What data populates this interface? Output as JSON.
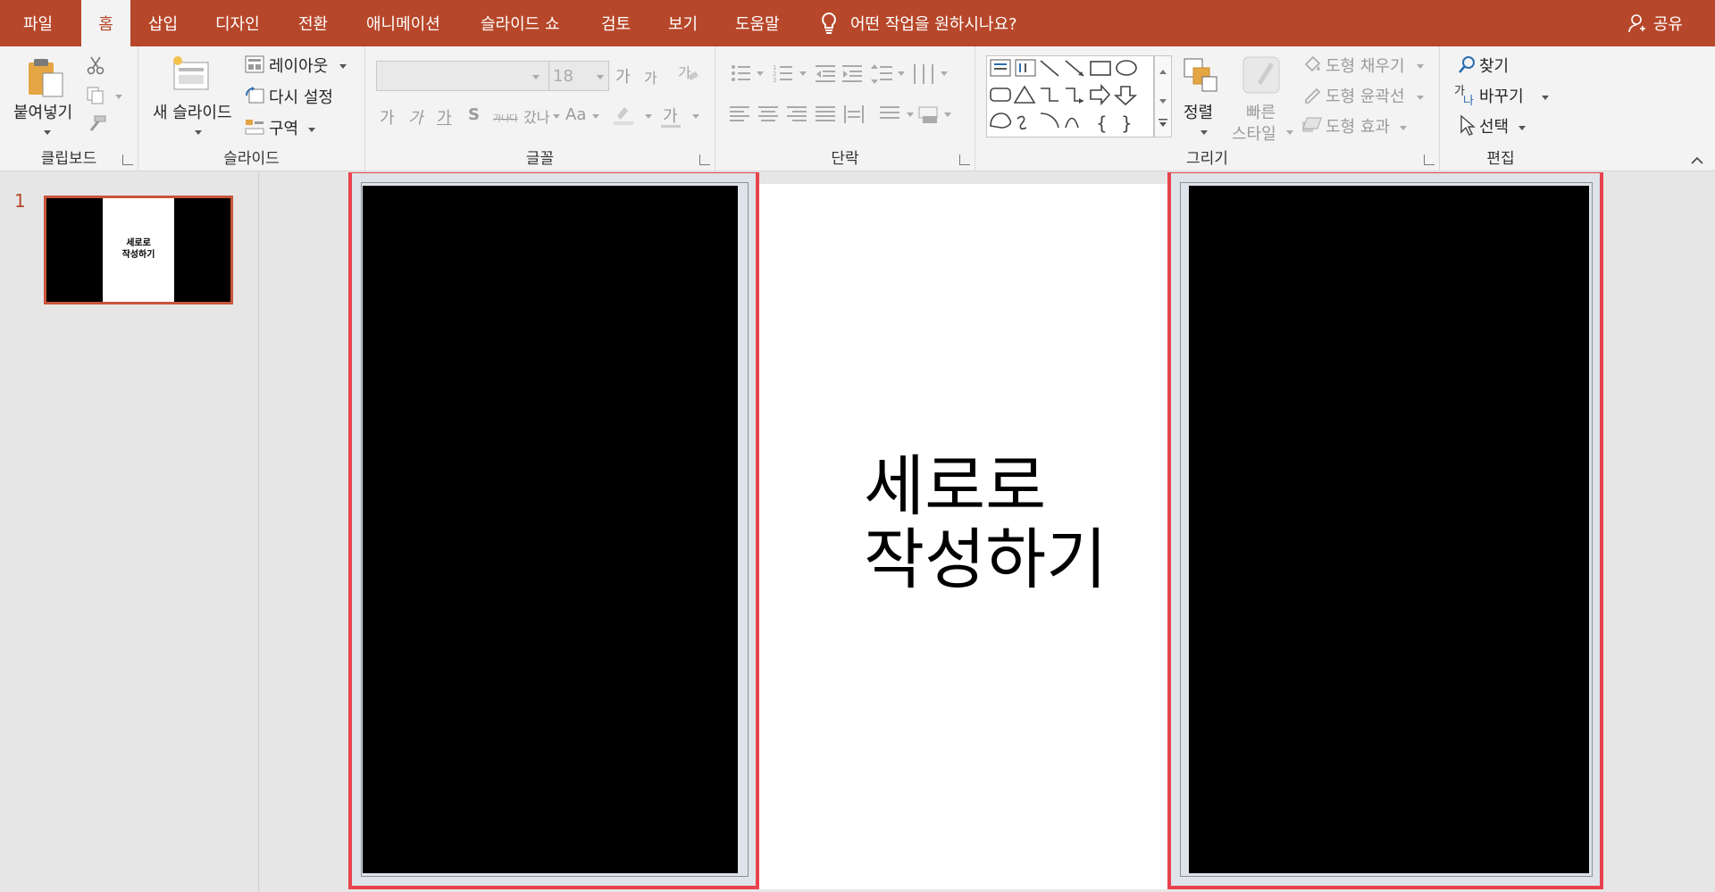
{
  "menu": {
    "tabs": [
      {
        "label": "파일"
      },
      {
        "label": "홈"
      },
      {
        "label": "삽입"
      },
      {
        "label": "디자인"
      },
      {
        "label": "전환"
      },
      {
        "label": "애니메이션"
      },
      {
        "label": "슬라이드 쇼"
      },
      {
        "label": "검토"
      },
      {
        "label": "보기"
      },
      {
        "label": "도움말"
      }
    ],
    "active_tab": "홈",
    "tell_me": "어떤 작업을 원하시나요?",
    "share": "공유"
  },
  "ribbon": {
    "clipboard": {
      "label": "클립보드",
      "paste": "붙여넣기"
    },
    "slides": {
      "label": "슬라이드",
      "new_slide": "새 슬라이드",
      "layout": "레이아웃",
      "reset": "다시 설정",
      "section": "구역"
    },
    "font": {
      "label": "글꼴",
      "font_name": "",
      "font_size": "18",
      "grow": "가",
      "shrink": "가",
      "bold": "가",
      "italic": "가",
      "underline": "가",
      "shadow": "S",
      "strike": "가나다",
      "spacing": "갔나",
      "case": "Aa",
      "color": "가"
    },
    "paragraph": {
      "label": "단락"
    },
    "drawing": {
      "label": "그리기",
      "arrange": "정렬",
      "quick_styles_1": "빠른",
      "quick_styles_2": "스타일",
      "shape_fill": "도형 채우기",
      "shape_outline": "도형 윤곽선",
      "shape_effects": "도형 효과"
    },
    "editing": {
      "label": "편집",
      "find": "찾기",
      "replace": "바꾸기",
      "select": "선택"
    }
  },
  "thumbnails": {
    "number": "1",
    "text_line1": "세로로",
    "text_line2": "작성하기"
  },
  "slide": {
    "title_line1": "세로로",
    "title_line2": "작성하기"
  },
  "colors": {
    "accent": "#b7472a",
    "highlight": "#e8434d",
    "panel_fill": "#000000"
  }
}
